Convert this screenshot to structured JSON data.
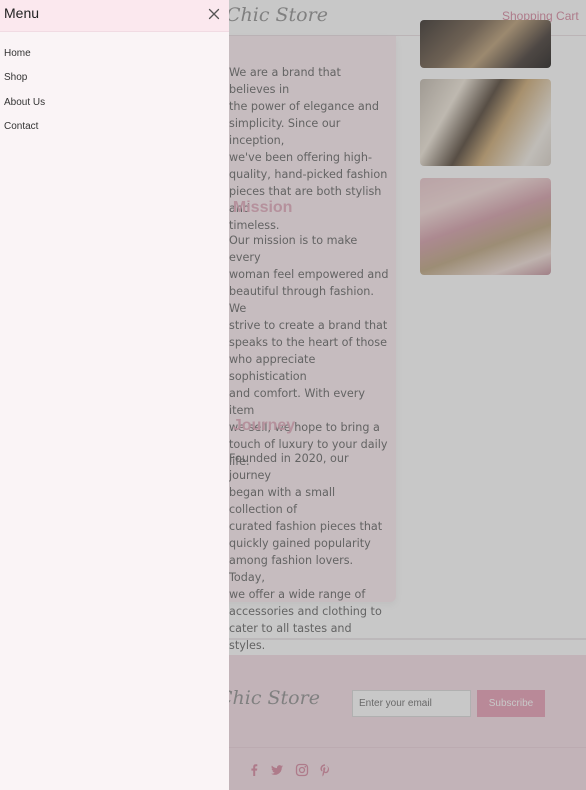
{
  "header": {
    "brand": "Chic Store",
    "cart_link": "Shopping Cart"
  },
  "about": {
    "paragraph": "We are a brand that believes in\nthe power of elegance and\nsimplicity. Since our inception,\nwe've been offering high-\nquality, hand-picked fashion\npieces that are both stylish and\ntimeless.",
    "mission_heading": "Our Mission",
    "mission_paragraph": "Our mission is to make every\nwoman feel empowered and\nbeautiful through fashion. We\nstrive to create a brand that\nspeaks to the heart of those\nwho appreciate sophistication\nand comfort. With every item\nwe sell, we hope to bring a\ntouch of luxury to your daily\nlife.",
    "journey_heading": "Our Journey",
    "journey_paragraph": "Founded in 2020, our journey\nbegan with a small collection of\ncurated fashion pieces that\nquickly gained popularity\namong fashion lovers. Today,\nwe offer a wide range of\naccessories and clothing to\ncater to all tastes and styles."
  },
  "footer": {
    "brand": "Chic Store",
    "email_placeholder": "Enter your email",
    "subscribe_label": "Subscribe",
    "social_icons": [
      "facebook-icon",
      "twitter-icon",
      "instagram-icon",
      "pinterest-icon"
    ]
  },
  "menu": {
    "title": "Menu",
    "items": [
      {
        "label": "Home"
      },
      {
        "label": "Shop"
      },
      {
        "label": "About Us"
      },
      {
        "label": "Contact"
      }
    ]
  },
  "colors": {
    "accent": "#e79ab2",
    "drawer_header": "#fbe8ee",
    "drawer_bg": "#faf4f6",
    "footer_bg": "#f6dde6"
  }
}
